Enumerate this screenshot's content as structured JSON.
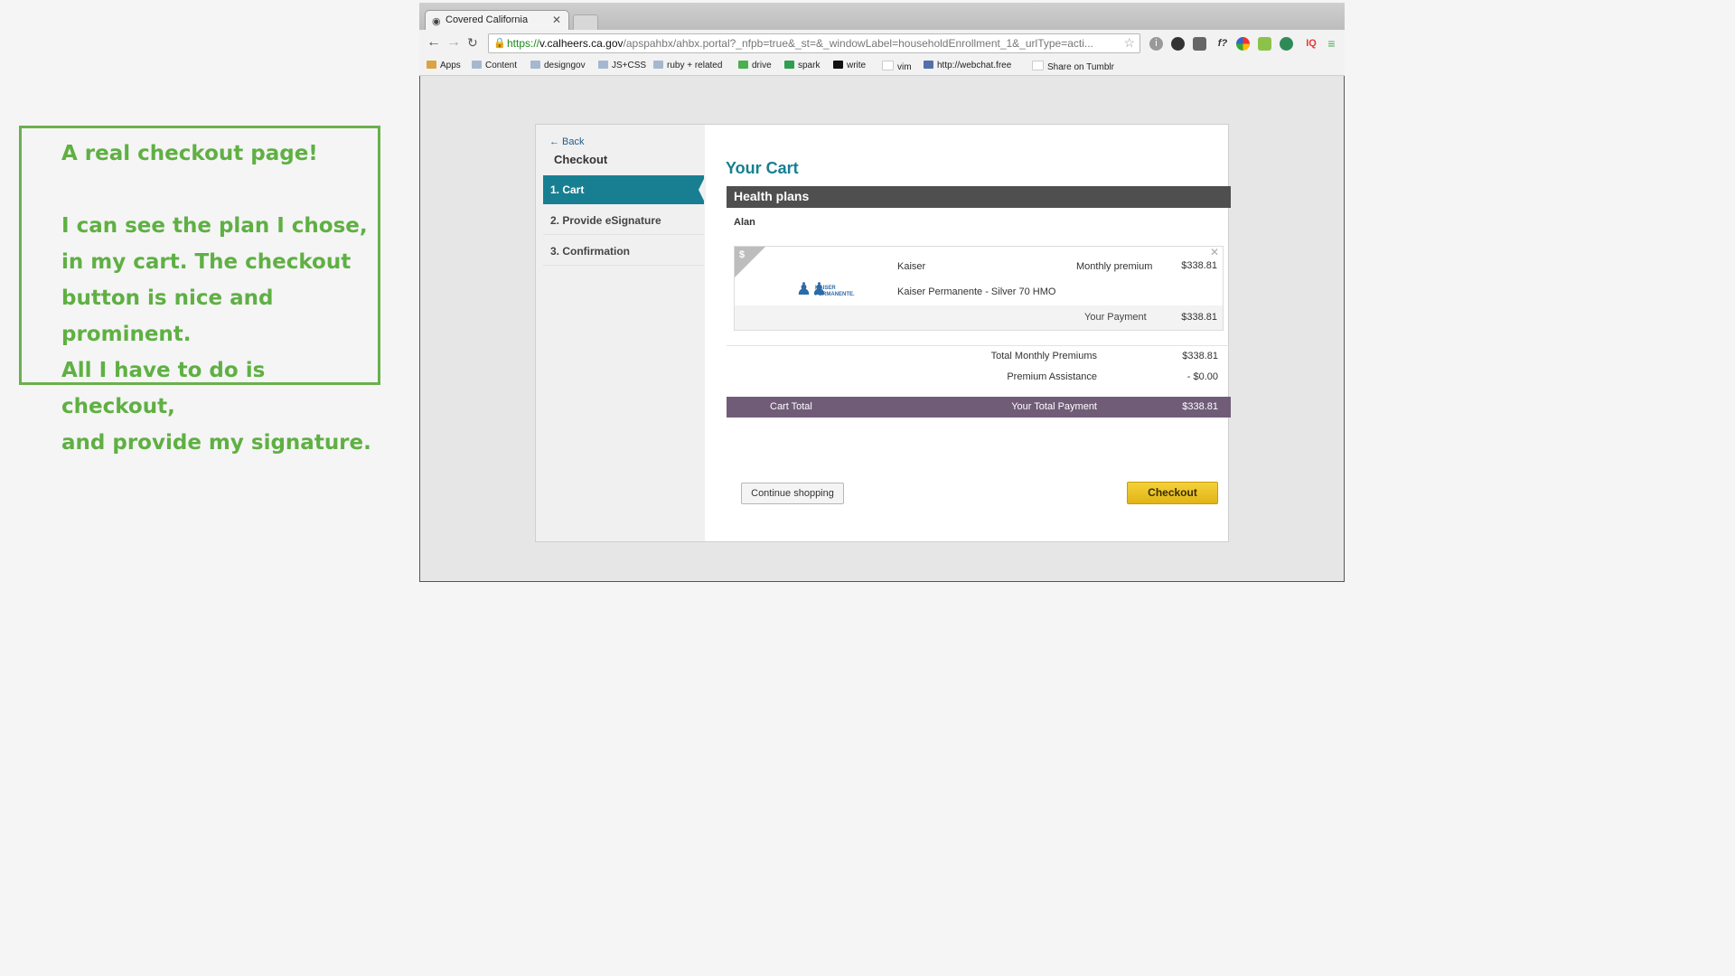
{
  "annotation": {
    "line1": "A real checkout page!",
    "line2": "I can see the plan I chose,",
    "line3": "in my cart. The checkout",
    "line4": "button is nice and prominent.",
    "line5": "All I have to do is checkout,",
    "line6": "and provide my signature."
  },
  "browser": {
    "tab_title": "Covered California",
    "url": {
      "scheme": "https://",
      "host": "v.calheers.ca.gov",
      "path": "/apspahbx/ahbx.portal?_nfpb=true&_st=&_windowLabel=householdEnrollment_1&_urlType=acti..."
    },
    "bookmarks": [
      "Apps",
      "Content",
      "designgov",
      "JS+CSS",
      "ruby + related",
      "drive",
      "spark",
      "write",
      "vim",
      "http://webchat.free",
      "Share on Tumblr"
    ]
  },
  "sidebar": {
    "back": "← Back",
    "title": "Checkout",
    "steps": [
      "1. Cart",
      "2. Provide eSignature",
      "3. Confirmation"
    ]
  },
  "cart": {
    "title": "Your Cart",
    "section": "Health plans",
    "member": "Alan",
    "plan": {
      "logo_text": "KAISER PERMANENTE.",
      "carrier": "Kaiser",
      "name": "Kaiser Permanente - Silver 70 HMO",
      "monthly_premium_label": "Monthly premium",
      "monthly_premium": "$338.81",
      "payment_label": "Your Payment",
      "payment": "$338.81"
    },
    "totals": {
      "monthly_label": "Total Monthly Premiums",
      "monthly": "$338.81",
      "assistance_label": "Premium Assistance",
      "assistance": "- $0.00",
      "cart_total_label": "Cart Total",
      "your_total_label": "Your Total Payment",
      "your_total": "$338.81"
    },
    "buttons": {
      "continue": "Continue shopping",
      "checkout": "Checkout"
    }
  },
  "colors": {
    "annotation": "#5fb043",
    "accent": "#177f91",
    "total_bar": "#715c78",
    "checkout_button": "#f3d13b"
  }
}
